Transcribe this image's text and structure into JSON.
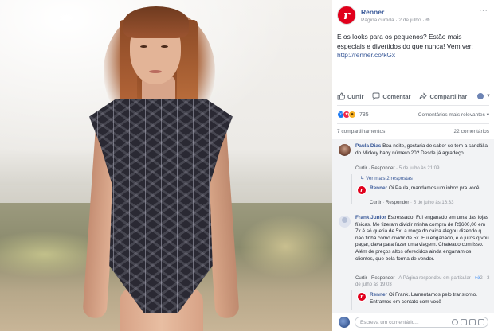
{
  "post": {
    "page_name": "Renner",
    "page_meta": "Página curtida · 2 de julho · ",
    "logo_letter": "r",
    "text": "E os looks para os pequenos? Estão mais especiais e divertidos do que nunca! Vem ver: ",
    "link": "http://ren­ner.co/kGx",
    "more": "···"
  },
  "actions": {
    "like": "Curtir",
    "comment": "Comentar",
    "share": "Compartilhar"
  },
  "reactions": {
    "count": "785",
    "relevance": "Comentários mais relevantes ▾"
  },
  "stats": {
    "shares": "7 compartilhamentos",
    "comments": "22 comentários"
  },
  "comments": [
    {
      "author": "Paula Dias",
      "text": "Boa noite, gostaria de saber se tem a sandália do Mickey baby número 20? Desde já agradeço.",
      "like": "Curtir",
      "reply": "Responder",
      "time": "5 de julho às 21:09",
      "more_replies": "Ver mais 2 respostas",
      "reply_author": "Renner",
      "reply_text": "Oi Paula, mandamos um inbox pra você.",
      "reply_like": "Curtir",
      "reply_reply": "Responder",
      "reply_time": "5 de julho às 16:33"
    },
    {
      "author": "Frank Junior",
      "text": "Estressado! Fui enganado em uma das lojas físicas. Me fizeram dividir minha compra de R$600,00 em 7x é só queria de 5x, a moça do caixa alegou dizendo q não tinha como dividir de 5x. Fui enganado, e o juros q vou pagar, dava para fazer uma viagem. Chateado com isso. Além de preços altos oferecidos ainda enganam os clientes, que bela forma de vender.",
      "like": "Curtir",
      "reply": "Responder",
      "status": "A Página respondeu em particular",
      "replies_count": "2",
      "time": "3 de julho às 19:03",
      "reply_author": "Renner",
      "reply_text": "Oi Frank. Lamentamos pelo transtorno. Entramos em contato com você"
    }
  ],
  "composer": {
    "placeholder": "Escreva um comentário..."
  }
}
